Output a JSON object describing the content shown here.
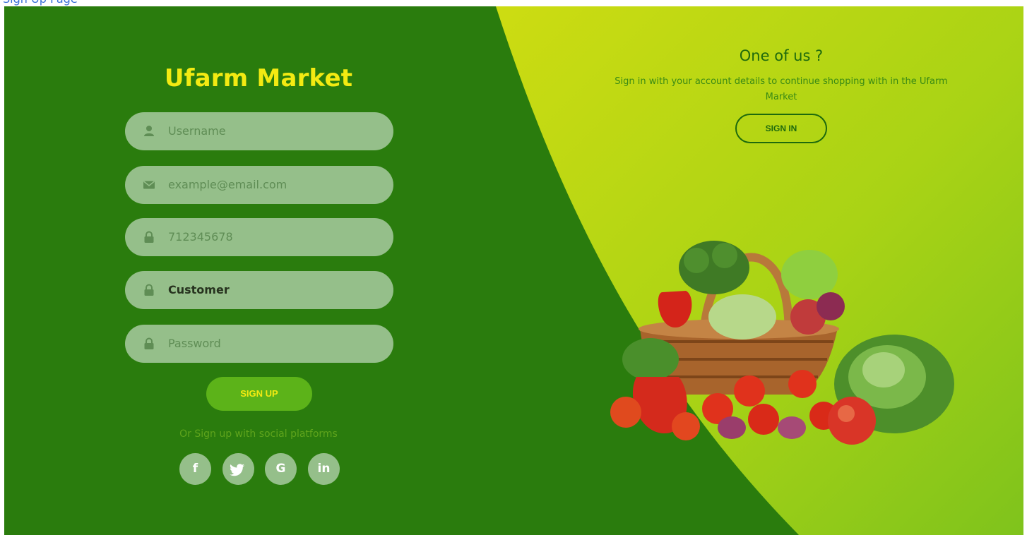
{
  "browser_fragment": "Sign Up Page",
  "form": {
    "brand_title": "Ufarm Market",
    "fields": {
      "username": {
        "placeholder": "Username",
        "icon": "user-icon"
      },
      "email": {
        "placeholder": "example@email.com",
        "icon": "envelope-icon"
      },
      "phone": {
        "value": "712345678",
        "icon": "lock-icon"
      },
      "role": {
        "value": "Customer",
        "icon": "lock-icon"
      },
      "password": {
        "placeholder": "Password",
        "icon": "lock-icon"
      }
    },
    "signup_label": "SIGN UP",
    "social_label": "Or Sign up with social platforms",
    "social": [
      {
        "name": "facebook",
        "glyph": "f"
      },
      {
        "name": "twitter",
        "glyph": "twitter-icon"
      },
      {
        "name": "google",
        "glyph": "G"
      },
      {
        "name": "linkedin",
        "glyph": "in"
      }
    ]
  },
  "promo": {
    "title": "One of us ?",
    "text": "Sign in with your account details to continue shopping with in the Ufarm Market",
    "signin_label": "SIGN IN",
    "image": "vegetable-basket"
  },
  "colors": {
    "left_bg": "#2a7c0d",
    "right_bg_light": "#c7da12",
    "right_bg_dark": "#8dc419",
    "brand": "#f3ea12",
    "field_bg": "#95bf8a",
    "button": "#5cb319"
  }
}
